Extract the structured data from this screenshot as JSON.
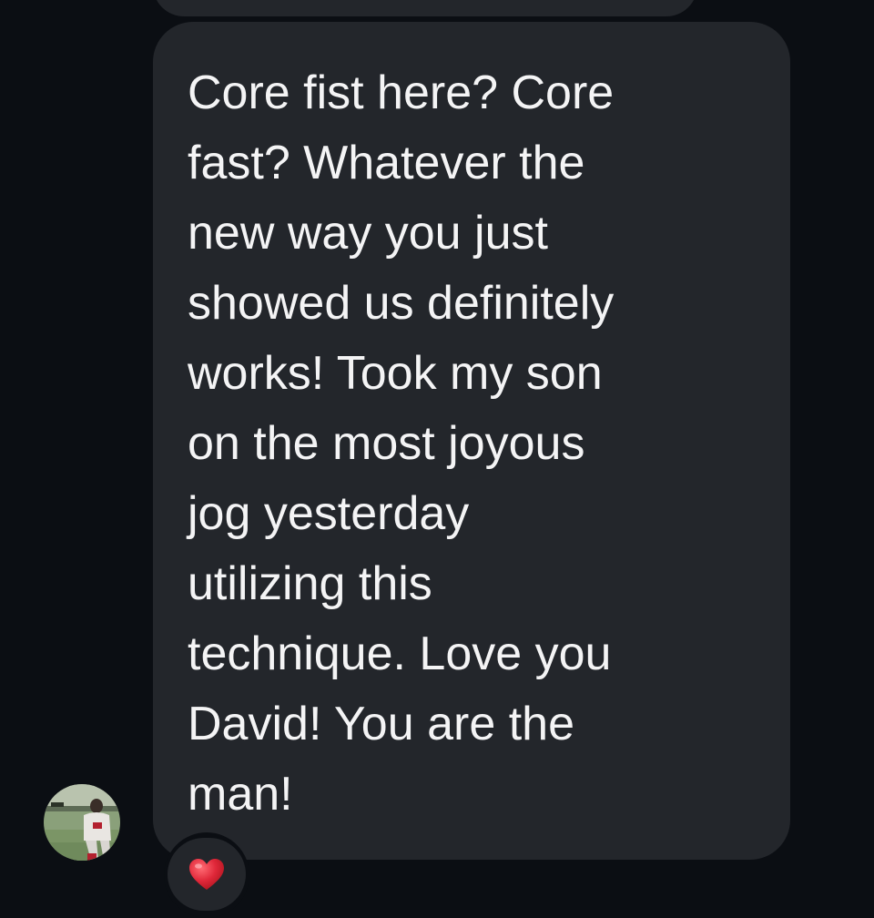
{
  "conversation": {
    "previous_message": {
      "text": ""
    },
    "message": {
      "text": "Core fist here? Core\nfast? Whatever the\nnew way you just\nshowed us definitely\nworks! Took my son\non the most joyous\njog yesterday\nutilizing this\ntechnique. Love you\nDavid! You are the\nman!",
      "reaction": "red-heart-icon"
    },
    "sender": {
      "avatar": "baseball-player-photo"
    }
  },
  "colors": {
    "background": "#0b0e13",
    "bubble": "#23262b",
    "text": "#f4f4f5",
    "heart": "#e0283a"
  }
}
